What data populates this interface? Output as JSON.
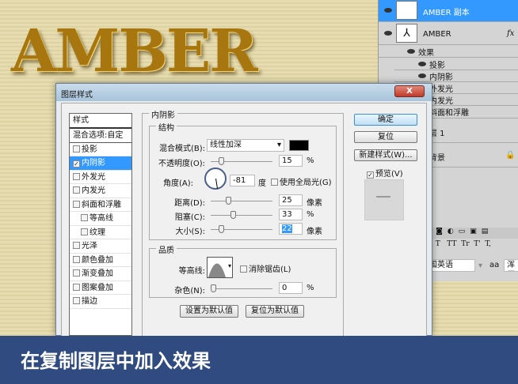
{
  "canvas": {
    "logo_text": "AMBER"
  },
  "layers": {
    "rows": [
      {
        "name": "AMBER 副本",
        "selected": true
      },
      {
        "name": "AMBER",
        "fx": "fx"
      }
    ],
    "effects_label": "效果",
    "effects": [
      "投影",
      "内阴影",
      "外发光",
      "内发光",
      "斜面和浮雕"
    ],
    "layer1": "层 1",
    "background": "背景",
    "font_styles": "T  T   TT  Tr  T'  T,",
    "language": "国英语",
    "aa_label": "aa",
    "aa_value": "浑厚"
  },
  "dialog": {
    "title": "图层样式",
    "close": "X",
    "styles_header": "样式",
    "blend_options": "混合选项:自定",
    "styles": [
      {
        "label": "投影",
        "checked": false
      },
      {
        "label": "内阴影",
        "checked": true,
        "selected": true
      },
      {
        "label": "外发光",
        "checked": false
      },
      {
        "label": "内发光",
        "checked": false
      },
      {
        "label": "斜面和浮雕",
        "checked": false
      },
      {
        "label": "等高线",
        "checked": false,
        "indent": true
      },
      {
        "label": "纹理",
        "checked": false,
        "indent": true
      },
      {
        "label": "光泽",
        "checked": false
      },
      {
        "label": "颜色叠加",
        "checked": false
      },
      {
        "label": "渐变叠加",
        "checked": false
      },
      {
        "label": "图案叠加",
        "checked": false
      },
      {
        "label": "描边",
        "checked": false
      }
    ],
    "section_title": "内阴影",
    "structure": {
      "title": "结构",
      "blend_mode_label": "混合模式(B):",
      "blend_mode": "线性加深",
      "color": "#000000",
      "opacity_label": "不透明度(O):",
      "opacity": "15",
      "opacity_unit": "%",
      "angle_label": "角度(A):",
      "angle": "-81",
      "angle_unit": "度",
      "global_light": "使用全局光(G)",
      "distance_label": "距离(D):",
      "distance": "25",
      "distance_unit": "像素",
      "choke_label": "阻塞(C):",
      "choke": "33",
      "choke_unit": "%",
      "size_label": "大小(S):",
      "size": "22",
      "size_unit": "像素"
    },
    "quality": {
      "title": "品质",
      "contour_label": "等高线:",
      "antialias": "消除锯齿(L)",
      "noise_label": "杂色(N):",
      "noise": "0",
      "noise_unit": "%"
    },
    "set_default": "设置为默认值",
    "reset_default": "复位为默认值",
    "ok": "确定",
    "reset": "复位",
    "new_style": "新建样式(W)...",
    "preview": "预览(V)"
  },
  "banner": {
    "text": "在复制图层中加入效果"
  }
}
